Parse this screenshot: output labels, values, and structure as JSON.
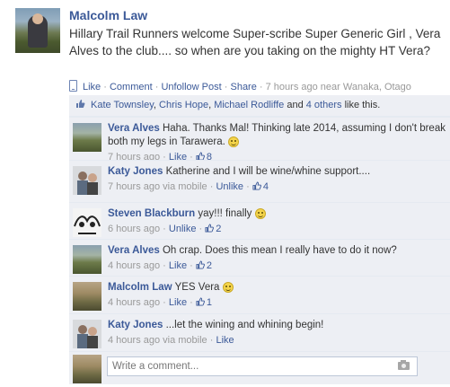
{
  "post": {
    "author": "Malcolm Law",
    "text": "Hillary Trail Runners welcome Super-scribe Super Generic Girl , Vera Alves to the club.... so when are you taking on the mighty HT Vera?",
    "actions": {
      "like": "Like",
      "comment": "Comment",
      "unfollow": "Unfollow Post",
      "share": "Share",
      "time": "7 hours ago",
      "near": "near",
      "place": "Wanaka, Otago"
    },
    "separator": " · "
  },
  "likes": {
    "people": [
      "Kate Townsley",
      "Chris Hope",
      "Michael Rodliffe"
    ],
    "and": "and",
    "others": "4 others",
    "suffix": "like this."
  },
  "comments": [
    {
      "name": "Vera Alves",
      "text": "Haha. Thanks Mal! Thinking late 2014, assuming I don't break both my legs in Tarawera.",
      "time": "7 hours ago",
      "action": "Like",
      "count": "8",
      "has_smile": true
    },
    {
      "name": "Katy Jones",
      "text": "Katherine and I will be wine/whine support....",
      "time": "7 hours ago via mobile",
      "action": "Unlike",
      "count": "4"
    },
    {
      "name": "Steven Blackburn",
      "text": "yay!!! finally",
      "time": "6 hours ago",
      "action": "Unlike",
      "count": "2",
      "has_smile": true
    },
    {
      "name": "Vera Alves",
      "text": "Oh crap. Does this mean I really have to do it now?",
      "time": "4 hours ago",
      "action": "Like",
      "count": "2"
    },
    {
      "name": "Malcolm Law",
      "text": "YES Vera",
      "time": "4 hours ago",
      "action": "Like",
      "count": "1",
      "has_smile": true
    },
    {
      "name": "Katy Jones",
      "text": "...let the wining and whining begin!",
      "time": "4 hours ago via mobile",
      "action": "Like",
      "count": ""
    }
  ],
  "write_comment": {
    "placeholder": "Write a comment..."
  },
  "colors": {
    "link": "#3b5998",
    "meta": "#999999",
    "panel": "#edeff4"
  }
}
